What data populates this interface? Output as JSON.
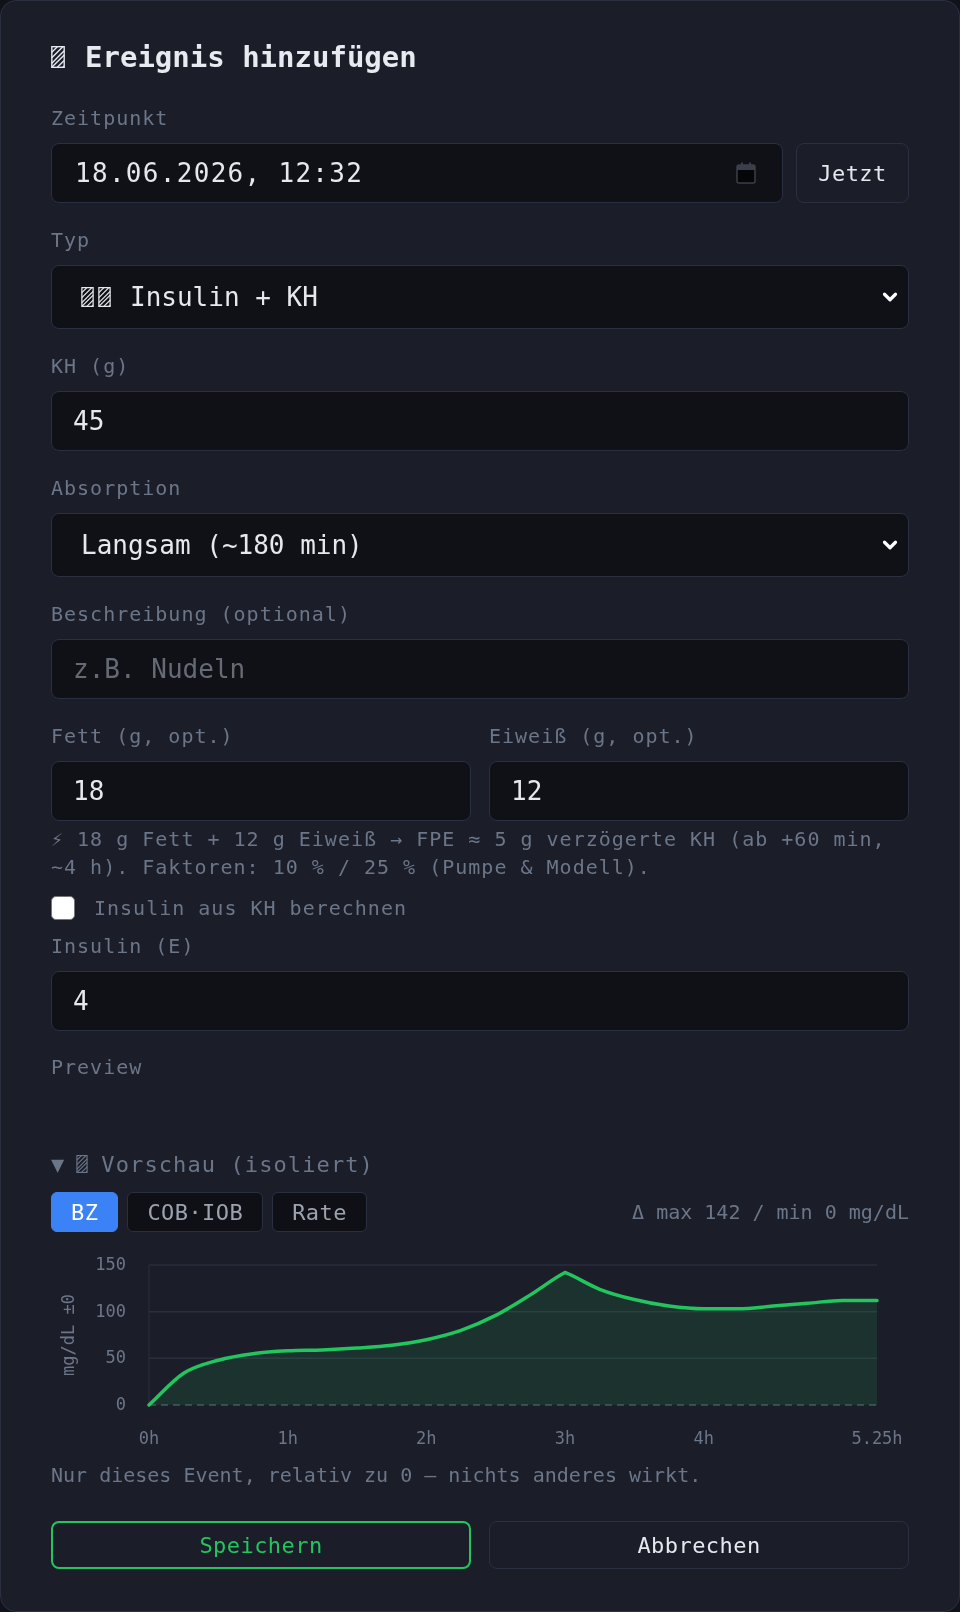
{
  "dialog": {
    "title": "Ereignis hinzufügen"
  },
  "time": {
    "label": "Zeitpunkt",
    "value": "18.06.2026, 12:32",
    "button": "Jetzt"
  },
  "type": {
    "label": "Typ",
    "value": "Insulin + KH"
  },
  "carbs": {
    "label": "KH (g)",
    "value": "45"
  },
  "absorption": {
    "label": "Absorption",
    "value": "Langsam (~180 min)"
  },
  "description": {
    "label": "Beschreibung (optional)",
    "placeholder": "z.B. Nudeln"
  },
  "fat": {
    "label": "Fett (g, opt.)",
    "value": "18"
  },
  "protein": {
    "label": "Eiweiß (g, opt.)",
    "value": "12"
  },
  "fpe_note": "⚡ 18 g Fett + 12 g Eiweiß → FPE ≈ 5 g verzögerte KH (ab +60 min, ~4 h). Faktoren: 10 % / 25 % (Pumpe & Modell).",
  "insulin_from_carbs": {
    "label": "Insulin aus KH berechnen",
    "checked": false
  },
  "insulin": {
    "label": "Insulin (E)",
    "value": "4"
  },
  "preview_label": "Preview",
  "preview": {
    "toggle": "▼",
    "title": "Vorschau (isoliert)",
    "tabs": [
      {
        "label": "BZ",
        "selected": true
      },
      {
        "label": "COB·IOB",
        "selected": false
      },
      {
        "label": "Rate",
        "selected": false
      }
    ],
    "summary": "Δ max 142 / min 0 mg/dL",
    "chart_data": {
      "type": "area",
      "ylabel": "mg/dL ±0",
      "x": [
        0,
        0.25,
        0.5,
        0.75,
        1,
        1.25,
        1.5,
        1.75,
        2,
        2.25,
        2.5,
        2.75,
        3,
        3.25,
        3.5,
        3.75,
        4,
        4.25,
        4.5,
        4.75,
        5,
        5.25
      ],
      "series": [
        {
          "color": "#22c55e",
          "values": [
            0,
            34,
            48,
            55,
            58,
            59,
            61,
            64,
            70,
            80,
            96,
            118,
            142,
            124,
            113,
            106,
            103,
            103,
            106,
            109,
            112,
            112
          ]
        }
      ],
      "xlim": [
        0,
        5.25
      ],
      "ylim": [
        0,
        150
      ],
      "xticks": [
        {
          "value": 0,
          "label": "0h"
        },
        {
          "value": 1,
          "label": "1h"
        },
        {
          "value": 2,
          "label": "2h"
        },
        {
          "value": 3,
          "label": "3h"
        },
        {
          "value": 4,
          "label": "4h"
        },
        {
          "value": 5.25,
          "label": "5.25h"
        }
      ],
      "yticks": [
        0,
        50,
        100,
        150
      ]
    },
    "note": "Nur dieses Event, relativ zu 0 — nichts anderes wirkt."
  },
  "buttons": [
    {
      "label": "Speichern",
      "kind": "primary"
    },
    {
      "label": "Abbrechen",
      "kind": "secondary"
    }
  ]
}
